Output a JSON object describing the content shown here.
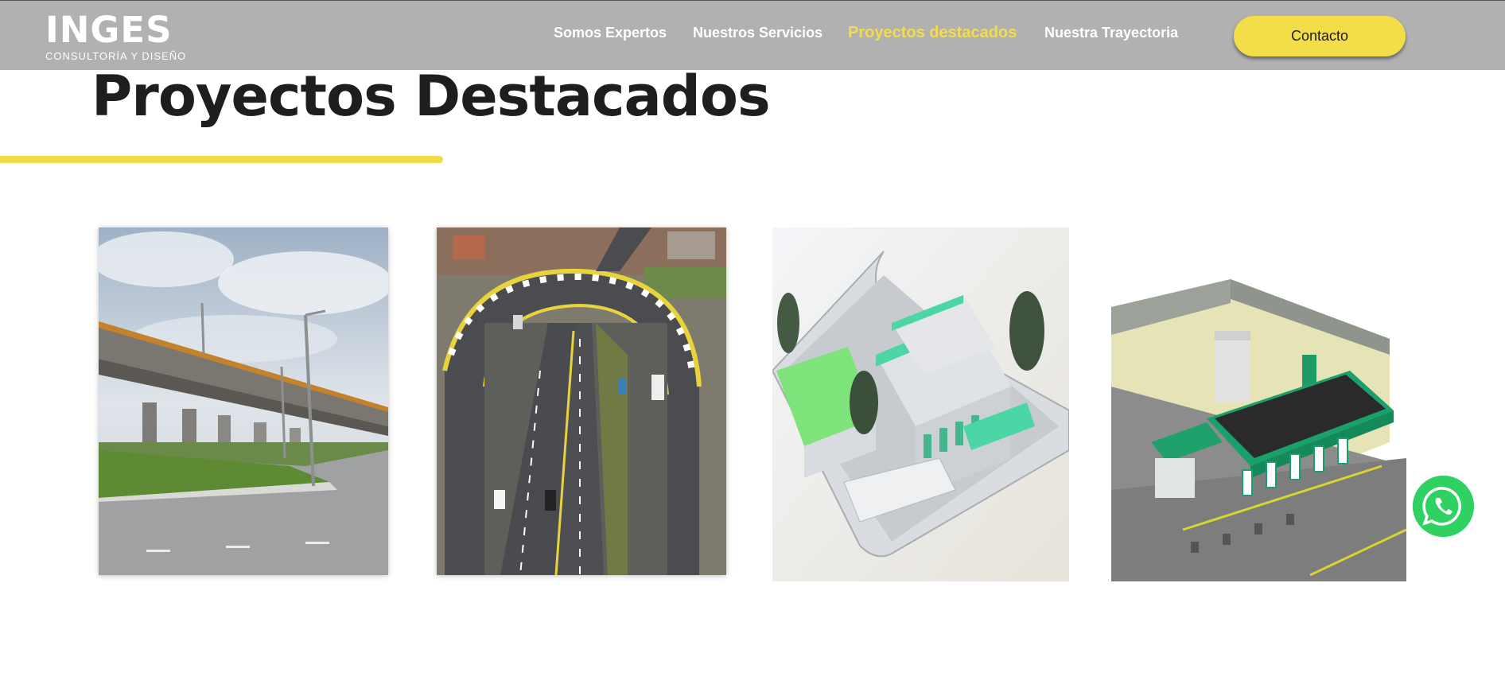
{
  "header": {
    "logo": {
      "word": "INGES",
      "tagline": "CONSULTORÍA Y DISEÑO"
    },
    "nav": [
      {
        "label": "Somos Expertos",
        "active": false
      },
      {
        "label": "Nuestros Servicios",
        "active": false
      },
      {
        "label": "Proyectos destacados",
        "active": true
      },
      {
        "label": "Nuestra Trayectoria",
        "active": false
      }
    ],
    "contact_label": "Contacto"
  },
  "section": {
    "title": "Proyectos Destacados"
  },
  "projects": [
    {
      "image": "bridge-overpass-photo"
    },
    {
      "image": "highway-loop-aerial-photo"
    },
    {
      "image": "building-3d-render"
    },
    {
      "image": "toll-station-3d-render"
    }
  ],
  "colors": {
    "header_bg": "#b1b1b1",
    "accent_yellow": "#f3de4a",
    "whatsapp_green": "#2fd163",
    "title_dark": "#1e1e1e"
  },
  "floating": {
    "icon": "whatsapp-icon"
  }
}
